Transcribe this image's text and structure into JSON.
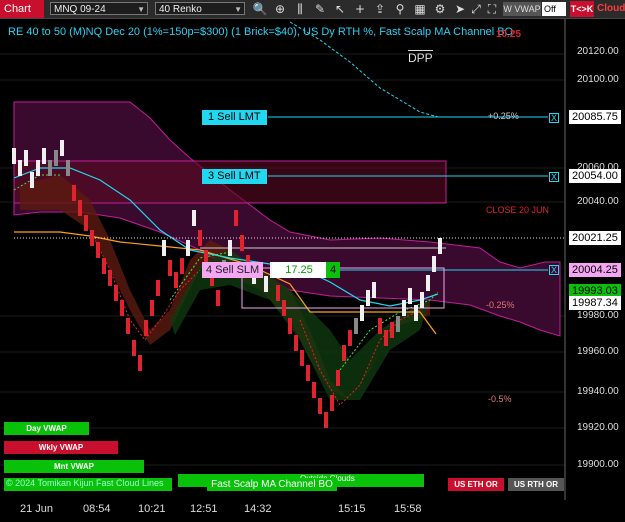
{
  "toolbar": {
    "app_label": "Chart",
    "instrument": "MNQ 09-24",
    "bar_type": "40 Renko",
    "vwap_label": "W VWAP",
    "off_label": "Off",
    "tk_label": "T<>K",
    "cloud_label": "Cloud",
    "icons": [
      "search-icon",
      "crosshair-icon",
      "bars-icon",
      "draw-icon",
      "pointer-icon",
      "plus-icon",
      "share-icon",
      "pin-icon",
      "grid-icon",
      "gear-icon",
      "arrow-icon",
      "diagonal-icon",
      "expand-icon"
    ]
  },
  "chart": {
    "title": "RE 40 to 50 (M)NQ Dec 20 (1%=150p=$300) (1 Brick=$40), US Dy RTH %, Fast Scalp MA Channel BO",
    "dpp_label": "DPP",
    "close_label": "CLOSE 20 JUN",
    "top_red_label": "10.25",
    "pct_labels": {
      "plus025": "+0.25%",
      "minus025": "-0.25%",
      "minus05": "-0.5%"
    },
    "axis_ticks": [
      "20120.00",
      "20100.00",
      "20060.00",
      "20040.00",
      "19980.00",
      "19960.00",
      "19940.00",
      "19920.00",
      "19900.00"
    ],
    "price_boxes": {
      "p20085": "20085.75",
      "p20054": "20054.00",
      "p20021": "20021.25",
      "p20004": "20004.25",
      "p19993": "19993.03",
      "p19987": "19987.34"
    },
    "colors": {
      "cyan": "#22d7f0",
      "magenta": "#c21d9b",
      "red": "#e0242f",
      "green": "#0ac10a",
      "orange": "#ff9f1c"
    }
  },
  "orders": {
    "sell1": "1 Sell LMT",
    "sell3": "3 Sell LMT",
    "sell4": "4 Sell SLM",
    "qty": "17.25",
    "count": "4",
    "x": "X"
  },
  "buttons": {
    "day_vwap": "Day VWAP",
    "wkly_vwap": "Wkly VWAP",
    "mnt_vwap": "Mnt VWAP",
    "fast_scalp": "Fast Scalp MA Channel BO",
    "outside_clouds": "Outside Clouds",
    "us_eth": "US ETH OR",
    "us_rth": "US RTH OR",
    "copyright": "© 2024 Tomikan Kijun Fast Cloud Lines"
  },
  "time_axis": [
    "21 Jun",
    "08:54",
    "10:21",
    "12:51",
    "14:32",
    "15:15",
    "15:58"
  ]
}
